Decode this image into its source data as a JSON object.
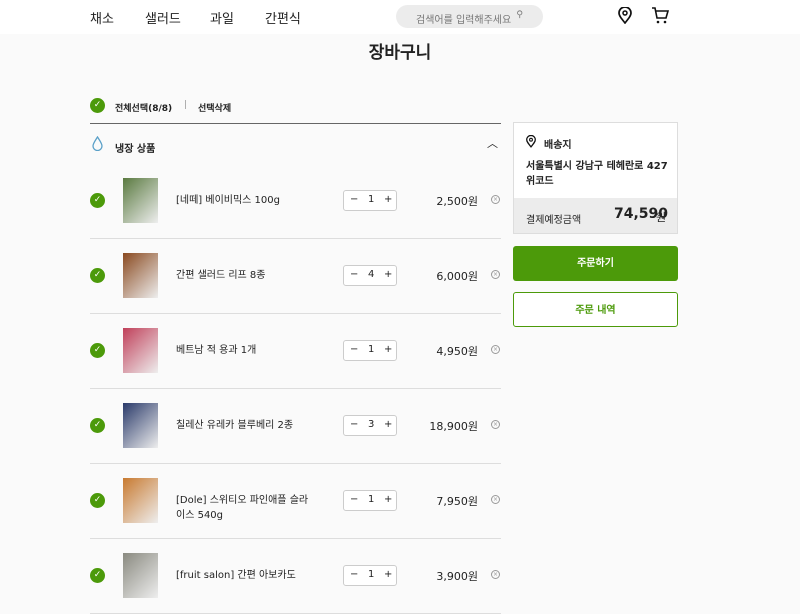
{
  "nav": {
    "items": [
      "채소",
      "샐러드",
      "과일",
      "간편식"
    ],
    "search_placeholder": "검색어를 입력해주세요"
  },
  "page": {
    "title": "장바구니",
    "select_all": "전체선택(8/8)",
    "delete_selected": "선택삭제",
    "section": "냉장 상품"
  },
  "items": [
    {
      "name": "[네떼] 베이비믹스 100g",
      "qty": "1",
      "price": "2,500원",
      "color": "#5a7a40"
    },
    {
      "name": "간편 샐러드 리프 8종",
      "qty": "4",
      "price": "6,000원",
      "color": "#8a4a20"
    },
    {
      "name": "베트남 적 용과 1개",
      "qty": "1",
      "price": "4,950원",
      "color": "#c0405a"
    },
    {
      "name": "칠레산 유레카 블루베리 2종",
      "qty": "3",
      "price": "18,900원",
      "color": "#2a3a6a"
    },
    {
      "name": "[Dole] 스위티오 파인애플 슬라이스 540g",
      "qty": "1",
      "price": "7,950원",
      "color": "#c87a30"
    },
    {
      "name": "[fruit salon] 간편 아보카도",
      "qty": "1",
      "price": "3,900원",
      "color": "#8a8a80"
    }
  ],
  "summary": {
    "delivery_label": "배송지",
    "address": "서울특별시 강남구 테헤란로 427 위코드",
    "total_label": "결제예정금액",
    "total": "74,590",
    "currency": "원",
    "order_button": "주문하기",
    "history_button": "주문 내역"
  },
  "colors": {
    "accent": "#4c9a0a"
  }
}
